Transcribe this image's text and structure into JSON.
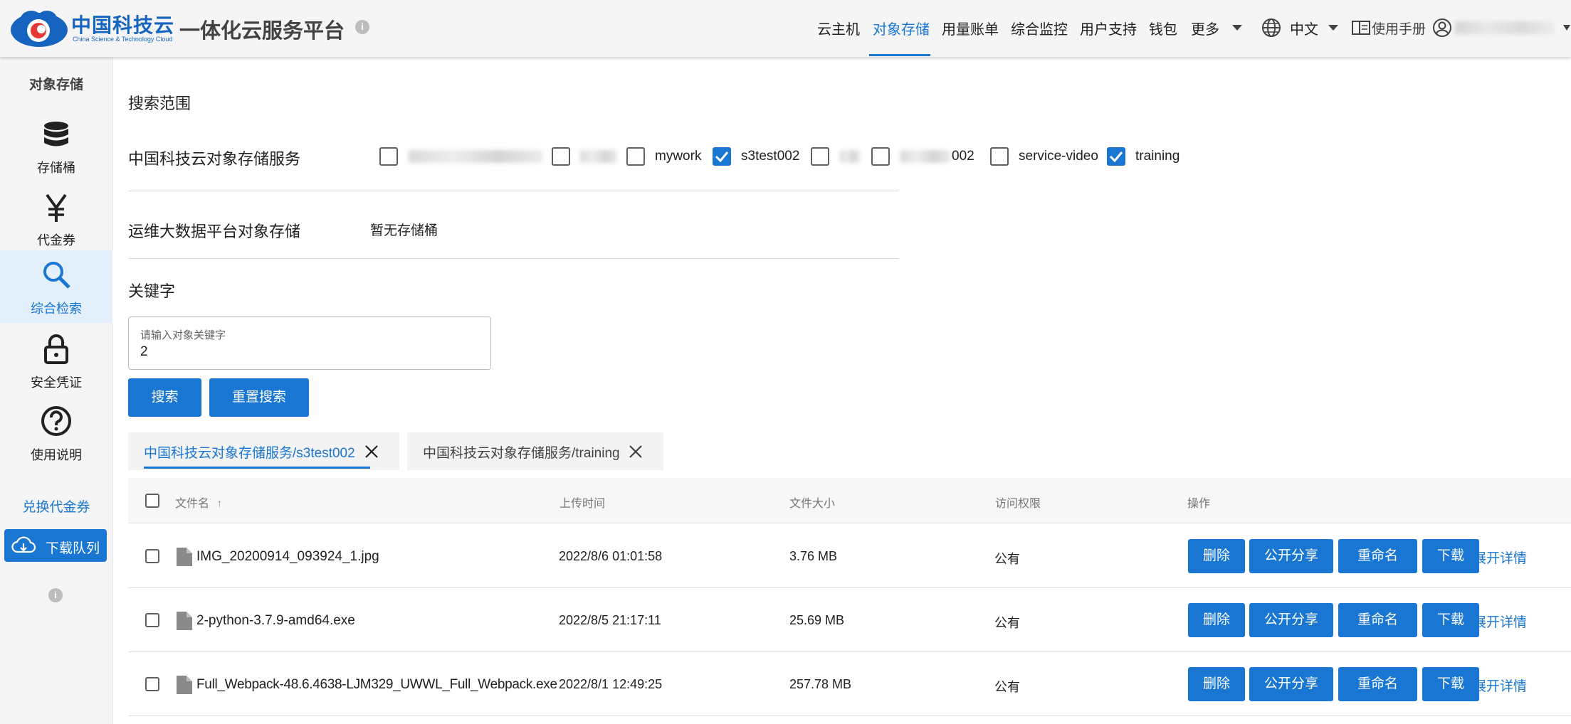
{
  "header": {
    "brand_cn": "中国科技云",
    "brand_en": "China Science & Technology Cloud",
    "title": "一体化云服务平台",
    "info_icon": "info-icon",
    "nav": [
      {
        "label": "云主机",
        "active": false
      },
      {
        "label": "对象存储",
        "active": true
      },
      {
        "label": "用量账单",
        "active": false
      },
      {
        "label": "综合监控",
        "active": false
      },
      {
        "label": "用户支持",
        "active": false
      },
      {
        "label": "钱包",
        "active": false
      },
      {
        "label": "更多",
        "active": false
      }
    ],
    "language": "中文",
    "manual": "使用手册"
  },
  "sidebar": {
    "title": "对象存储",
    "items": [
      {
        "label": "存储桶",
        "icon": "database-icon",
        "active": false
      },
      {
        "label": "代金券",
        "icon": "yen-icon",
        "active": false
      },
      {
        "label": "综合检索",
        "icon": "search-icon",
        "active": true
      },
      {
        "label": "安全凭证",
        "icon": "lock-icon",
        "active": false
      },
      {
        "label": "使用说明",
        "icon": "help-icon",
        "active": false
      }
    ],
    "exchange_link": "兑换代金券",
    "download_queue": "下载队列"
  },
  "search": {
    "scope_title": "搜索范围",
    "service1_label": "中国科技云对象存储服务",
    "buckets": [
      {
        "label": "",
        "checked": false
      },
      {
        "label": "",
        "checked": false
      },
      {
        "label": "mywork",
        "checked": false
      },
      {
        "label": "s3test002",
        "checked": true
      },
      {
        "label": "",
        "checked": false
      },
      {
        "label": "",
        "checked": false
      },
      {
        "label": "service-video",
        "checked": false
      },
      {
        "label": "training",
        "checked": true
      }
    ],
    "service2_label": "运维大数据平台对象存储",
    "service2_empty": "暂无存储桶",
    "keyword_title": "关键字",
    "keyword_placeholder": "请输入对象关键字",
    "keyword_value": "2",
    "search_button": "搜索",
    "reset_button": "重置搜索"
  },
  "tabs": [
    {
      "label": "中国科技云对象存储服务/s3test002",
      "active": true
    },
    {
      "label": "中国科技云对象存储服务/training",
      "active": false
    }
  ],
  "table": {
    "columns": [
      "文件名",
      "上传时间",
      "文件大小",
      "访问权限",
      "操作"
    ],
    "sort_indicator": "↑",
    "actions": [
      "删除",
      "公开分享",
      "重命名",
      "下载",
      "展开详情"
    ],
    "rows": [
      {
        "name": "IMG_20200914_093924_1.jpg",
        "time": "2022/8/6 01:01:58",
        "size": "3.76 MB",
        "access": "公有"
      },
      {
        "name": "2-python-3.7.9-amd64.exe",
        "time": "2022/8/5 21:17:11",
        "size": "25.69 MB",
        "access": "公有"
      },
      {
        "name": "Full_Webpack-48.6.4638-LJM329_UWWL_Full_Webpack.exe",
        "time": "2022/8/1 12:49:25",
        "size": "257.78 MB",
        "access": "公有"
      }
    ]
  },
  "colors": {
    "accent": "#1976d2",
    "header_bg": "#f5f5f5",
    "sidebar_active_bg": "#e3f0fc"
  }
}
